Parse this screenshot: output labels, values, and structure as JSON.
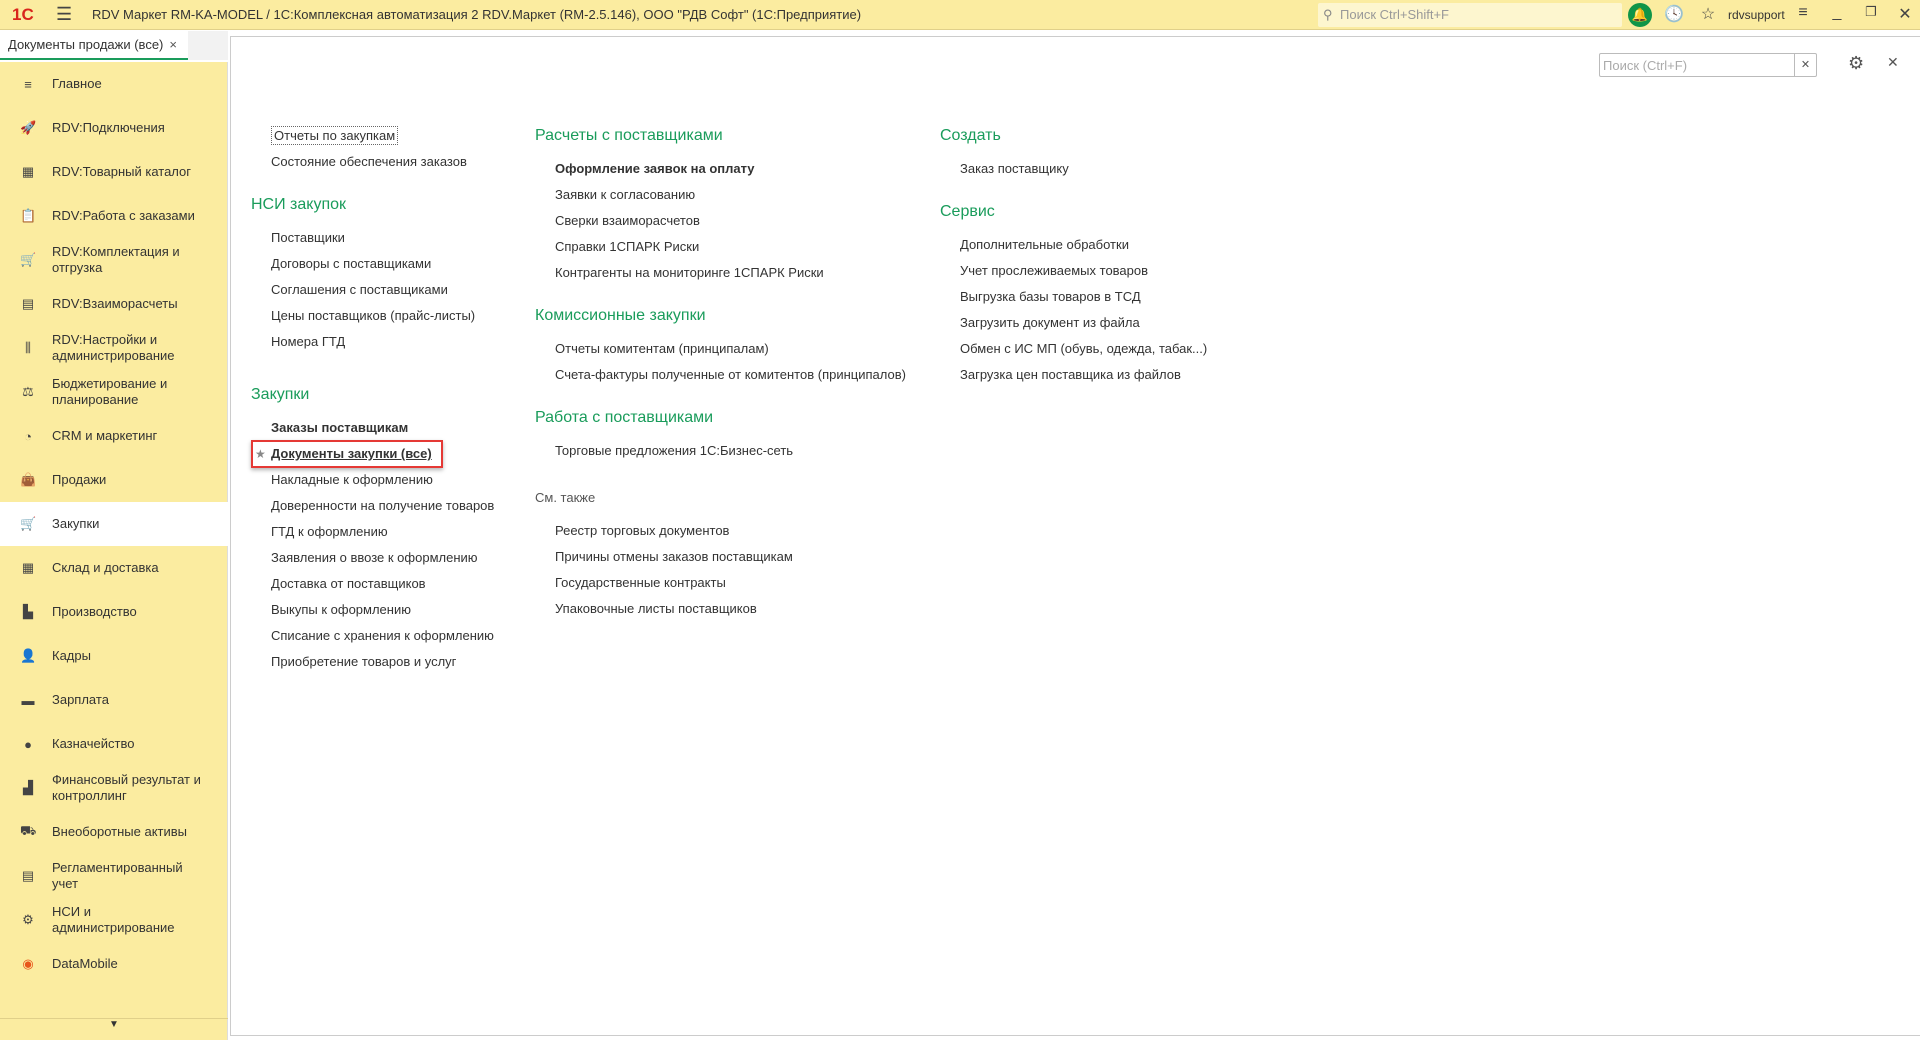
{
  "titlebar": {
    "title": "RDV Маркет RM-KA-MODEL / 1С:Комплексная автоматизация 2 RDV.Маркет (RM-2.5.146), ООО \"РДВ Софт\"  (1С:Предприятие)",
    "search_placeholder": "Поиск Ctrl+Shift+F",
    "user": "rdvsupport",
    "logo": "1С"
  },
  "tab": {
    "label": "Документы продажи (все)",
    "close": "×"
  },
  "sidebar": {
    "items": [
      {
        "label": "Главное",
        "icon": "menu-icon"
      },
      {
        "label": "RDV:Подключения",
        "icon": "rocket-icon"
      },
      {
        "label": "RDV:Товарный каталог",
        "icon": "grid-icon"
      },
      {
        "label": "RDV:Работа с заказами",
        "icon": "clipboard-icon"
      },
      {
        "label": "RDV:Комплектация и отгрузка",
        "icon": "cart-icon"
      },
      {
        "label": "RDV:Взаиморасчеты",
        "icon": "calculator-icon"
      },
      {
        "label": "RDV:Настройки и администрирование",
        "icon": "sliders-icon"
      },
      {
        "label": "Бюджетирование и планирование",
        "icon": "budget-icon"
      },
      {
        "label": "CRM и маркетинг",
        "icon": "pie-icon"
      },
      {
        "label": "Продажи",
        "icon": "bag-icon"
      },
      {
        "label": "Закупки",
        "icon": "cart-icon"
      },
      {
        "label": "Склад и доставка",
        "icon": "warehouse-icon"
      },
      {
        "label": "Производство",
        "icon": "factory-icon"
      },
      {
        "label": "Кадры",
        "icon": "person-icon"
      },
      {
        "label": "Зарплата",
        "icon": "card-icon"
      },
      {
        "label": "Казначейство",
        "icon": "coin-icon"
      },
      {
        "label": "Финансовый результат и контроллинг",
        "icon": "chart-icon"
      },
      {
        "label": "Внеоборотные активы",
        "icon": "truck-icon"
      },
      {
        "label": "Регламентированный учет",
        "icon": "report-icon"
      },
      {
        "label": "НСИ и администрирование",
        "icon": "gear-icon"
      },
      {
        "label": "DataMobile",
        "icon": "datamobile-icon"
      }
    ]
  },
  "main": {
    "search_placeholder": "Поиск (Ctrl+F)",
    "col1": {
      "top_items": [
        "Отчеты по закупкам",
        "Состояние обеспечения заказов"
      ],
      "groups": [
        {
          "title": "НСИ закупок",
          "items": [
            "Поставщики",
            "Договоры с поставщиками",
            "Соглашения с поставщиками",
            "Цены поставщиков (прайс-листы)",
            "Номера ГТД"
          ]
        },
        {
          "title": "Закупки",
          "items": [
            "Заказы поставщикам",
            "Документы закупки (все)",
            "Накладные к оформлению",
            "Доверенности на получение товаров",
            "ГТД к оформлению",
            "Заявления о ввозе к оформлению",
            "Доставка от поставщиков",
            "Выкупы к оформлению",
            "Списание с хранения к оформлению",
            "Приобретение товаров и услуг"
          ]
        }
      ]
    },
    "col2": {
      "groups": [
        {
          "title": "Расчеты с поставщиками",
          "items": [
            "Оформление заявок на оплату",
            "Заявки к согласованию",
            "Сверки взаиморасчетов",
            "Справки 1СПАРК Риски",
            "Контрагенты на мониторинге 1СПАРК Риски"
          ]
        },
        {
          "title": "Комиссионные закупки",
          "items": [
            "Отчеты комитентам (принципалам)",
            "Счета-фактуры полученные от комитентов (принципалов)"
          ]
        },
        {
          "title": "Работа с поставщиками",
          "items": [
            "Торговые предложения 1С:Бизнес-сеть"
          ]
        },
        {
          "title": "См. также",
          "items": [
            "Реестр торговых документов",
            "Причины отмены заказов поставщикам",
            "Государственные контракты",
            "Упаковочные листы поставщиков"
          ]
        }
      ]
    },
    "col3": {
      "groups": [
        {
          "title": "Создать",
          "items": [
            "Заказ поставщику"
          ]
        },
        {
          "title": "Сервис",
          "items": [
            "Дополнительные обработки",
            "Учет прослеживаемых товаров",
            "Выгрузка базы товаров в ТСД",
            "Загрузить документ из файла",
            "Обмен с ИС МП (обувь, одежда, табак...)",
            "Загрузка цен поставщика из файлов"
          ]
        }
      ]
    }
  }
}
